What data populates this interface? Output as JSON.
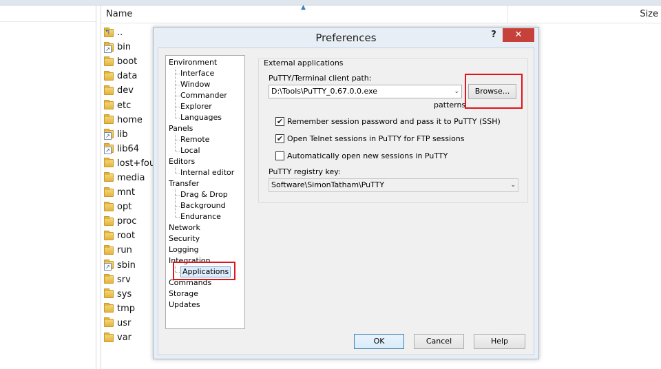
{
  "file_panel": {
    "columns": {
      "name": "Name",
      "size": "Size"
    },
    "items": [
      {
        "name": "..",
        "type": "up"
      },
      {
        "name": "bin",
        "type": "link"
      },
      {
        "name": "boot",
        "type": "folder"
      },
      {
        "name": "data",
        "type": "folder"
      },
      {
        "name": "dev",
        "type": "folder"
      },
      {
        "name": "etc",
        "type": "folder"
      },
      {
        "name": "home",
        "type": "folder"
      },
      {
        "name": "lib",
        "type": "link"
      },
      {
        "name": "lib64",
        "type": "link"
      },
      {
        "name": "lost+four",
        "type": "folder"
      },
      {
        "name": "media",
        "type": "folder"
      },
      {
        "name": "mnt",
        "type": "folder"
      },
      {
        "name": "opt",
        "type": "folder"
      },
      {
        "name": "proc",
        "type": "folder"
      },
      {
        "name": "root",
        "type": "folder"
      },
      {
        "name": "run",
        "type": "folder"
      },
      {
        "name": "sbin",
        "type": "link"
      },
      {
        "name": "srv",
        "type": "folder"
      },
      {
        "name": "sys",
        "type": "folder"
      },
      {
        "name": "tmp",
        "type": "folder"
      },
      {
        "name": "usr",
        "type": "folder"
      },
      {
        "name": "var",
        "type": "folder"
      }
    ]
  },
  "dialog": {
    "title": "Preferences",
    "help_glyph": "?",
    "close_glyph": "✕",
    "tree": [
      {
        "label": "Environment",
        "level": 0
      },
      {
        "label": "Interface",
        "level": 1
      },
      {
        "label": "Window",
        "level": 1
      },
      {
        "label": "Commander",
        "level": 1
      },
      {
        "label": "Explorer",
        "level": 1
      },
      {
        "label": "Languages",
        "level": 1
      },
      {
        "label": "Panels",
        "level": 0
      },
      {
        "label": "Remote",
        "level": 1
      },
      {
        "label": "Local",
        "level": 1
      },
      {
        "label": "Editors",
        "level": 0
      },
      {
        "label": "Internal editor",
        "level": 1
      },
      {
        "label": "Transfer",
        "level": 0
      },
      {
        "label": "Drag & Drop",
        "level": 1
      },
      {
        "label": "Background",
        "level": 1
      },
      {
        "label": "Endurance",
        "level": 1
      },
      {
        "label": "Network",
        "level": 0
      },
      {
        "label": "Security",
        "level": 0
      },
      {
        "label": "Logging",
        "level": 0
      },
      {
        "label": "Integration",
        "level": 0
      },
      {
        "label": "Applications",
        "level": 1,
        "selected": true
      },
      {
        "label": "Commands",
        "level": 0
      },
      {
        "label": "Storage",
        "level": 0
      },
      {
        "label": "Updates",
        "level": 0
      }
    ],
    "ext": {
      "group_title": "External applications",
      "putty_path_label": "PuTTY/Terminal client path:",
      "putty_path_value": "D:\\Tools\\PuTTY_0.67.0.0.exe",
      "browse_label": "Browse...",
      "patterns_label": "patterns",
      "checkboxes": [
        {
          "label": "Remember session password and pass it to PuTTY (SSH)",
          "checked": true
        },
        {
          "label": "Open Telnet sessions in PuTTY for FTP sessions",
          "checked": true
        },
        {
          "label": "Automatically open new sessions in PuTTY",
          "checked": false
        }
      ],
      "registry_label": "PuTTY registry key:",
      "registry_value": "Software\\SimonTatham\\PuTTY"
    },
    "buttons": {
      "ok": "OK",
      "cancel": "Cancel",
      "help": "Help"
    },
    "highlight_color": "#e0141b"
  }
}
